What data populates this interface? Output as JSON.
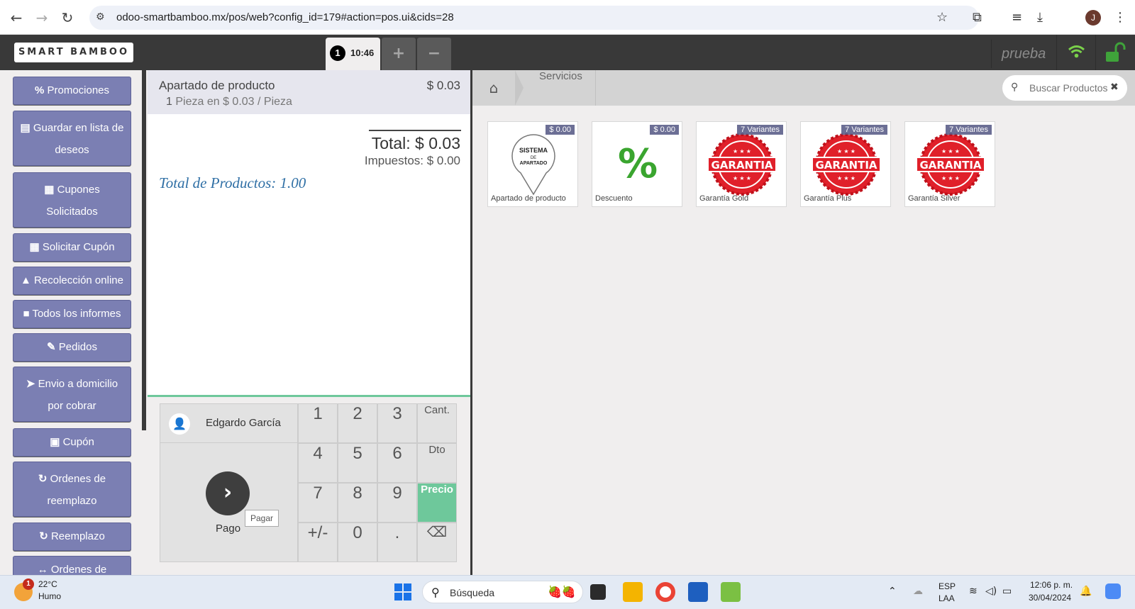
{
  "browser": {
    "url": "odoo-smartbamboo.mx/pos/web?config_id=179#action=pos.ui&cids=28",
    "profile_initial": "J"
  },
  "pos": {
    "logo": "SMART BAMBOO",
    "order_number": "1",
    "order_time": "10:46",
    "add_order": "+",
    "remove_order": "−",
    "user": "prueba"
  },
  "sidebar": {
    "items": [
      {
        "icon": "%",
        "label": "Promociones"
      },
      {
        "icon": "▤",
        "label": "Guardar en lista de",
        "label2": "deseos"
      },
      {
        "icon": "▦",
        "label": "Cupones",
        "label2": "Solicitados"
      },
      {
        "icon": "▦",
        "label": "Solicitar Cupón"
      },
      {
        "icon": "▲",
        "label": "Recolección online"
      },
      {
        "icon": "■",
        "label": "Todos los informes"
      },
      {
        "icon": "✎",
        "label": "Pedidos"
      },
      {
        "icon": "➤",
        "label": "Envio a domicilio",
        "label2": "por cobrar"
      },
      {
        "icon": "▣",
        "label": "Cupón"
      },
      {
        "icon": "↻",
        "label": "Ordenes de",
        "label2": "reemplazo"
      },
      {
        "icon": "↻",
        "label": "Reemplazo"
      },
      {
        "icon": "↔",
        "label": "Ordenes de"
      }
    ]
  },
  "order": {
    "line_name": "Apartado de producto",
    "line_price": "$ 0.03",
    "line_qty": "1",
    "line_detail": "Pieza en $ 0.03 / Pieza",
    "total": "Total: $ 0.03",
    "taxes": "Impuestos: $ 0.00",
    "product_count": "Total de Productos: 1.00"
  },
  "control": {
    "customer": "Edgardo García",
    "pay_label": "Pago",
    "pay_tooltip": "Pagar",
    "keys": [
      "1",
      "2",
      "3",
      "Cant.",
      "4",
      "5",
      "6",
      "Dto",
      "7",
      "8",
      "9",
      "Precio",
      "+/-",
      "0",
      ".",
      "⌫"
    ],
    "active_key": "Precio"
  },
  "products": {
    "breadcrumb": "Servicios",
    "search_placeholder": "Buscar Productos",
    "items": [
      {
        "name": "Apartado de producto",
        "tag": "$ 0.00",
        "image": "sistema-apartado",
        "img_text": [
          "SISTEMA",
          "DE",
          "APARTADO"
        ]
      },
      {
        "name": "Descuento",
        "tag": "$ 0.00",
        "image": "percent",
        "img_text": [
          "%"
        ]
      },
      {
        "name": "Garantía Gold",
        "tag": "7 Variantes",
        "image": "garantia",
        "img_text": [
          "GARANTIA"
        ]
      },
      {
        "name": "Garantía Plus",
        "tag": "7 Variantes",
        "image": "garantia",
        "img_text": [
          "GARANTIA"
        ]
      },
      {
        "name": "Garantía Silver",
        "tag": "7 Variantes",
        "image": "garantia",
        "img_text": [
          "GARANTIA"
        ]
      }
    ]
  },
  "taskbar": {
    "weather_badge": "1",
    "temperature": "22°C",
    "weather": "Humo",
    "search": "Búsqueda",
    "lang1": "ESP",
    "lang2": "LAA",
    "time": "12:06 p. m.",
    "date": "30/04/2024"
  },
  "colors": {
    "sidebar_button": "#7b7fb3",
    "active_key": "#6ec89b",
    "topbar": "#393939",
    "count_text": "#2f6fa5",
    "garantia_red": "#e0202a"
  }
}
